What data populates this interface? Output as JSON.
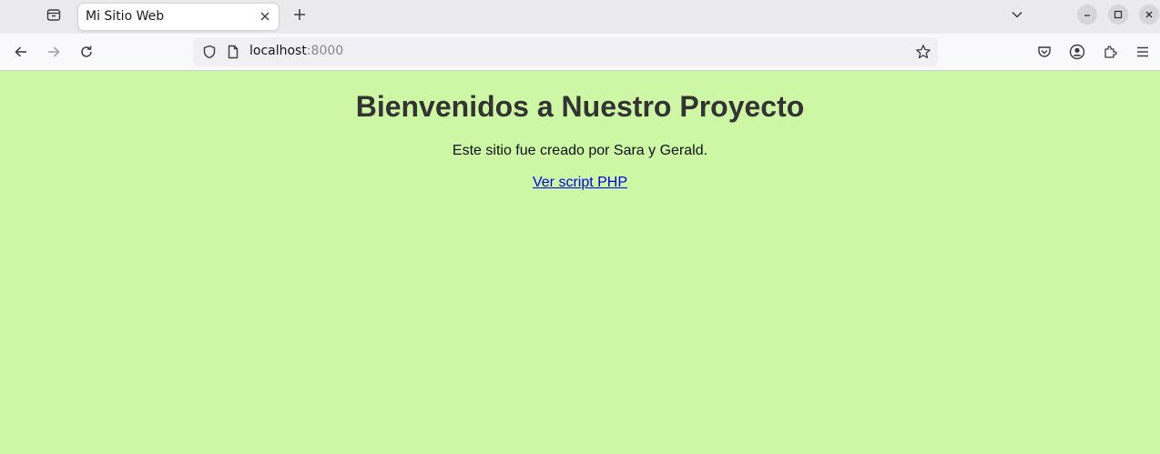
{
  "browser": {
    "tab": {
      "title": "Mi Sitio Web"
    },
    "address": {
      "host": "localhost",
      "port": ":8000"
    }
  },
  "page": {
    "heading": "Bienvenidos a Nuestro Proyecto",
    "subtitle": "Este sitio fue creado por Sara y Gerald.",
    "link_text": "Ver script PHP"
  },
  "icons": {
    "tab_list": "tab-list-icon",
    "close": "close-icon",
    "new_tab": "plus-icon",
    "overflow": "chevron-down-icon",
    "back": "back-arrow-icon",
    "forward": "forward-arrow-icon",
    "reload": "reload-icon",
    "shield": "shield-icon",
    "page": "page-icon",
    "bookmark": "star-icon",
    "pocket": "pocket-icon",
    "account": "account-icon",
    "extensions": "puzzle-icon",
    "menu": "hamburger-menu-icon"
  },
  "colors": {
    "page_background": "#cdf7a4",
    "heading": "#333333",
    "link": "#0000ee"
  }
}
